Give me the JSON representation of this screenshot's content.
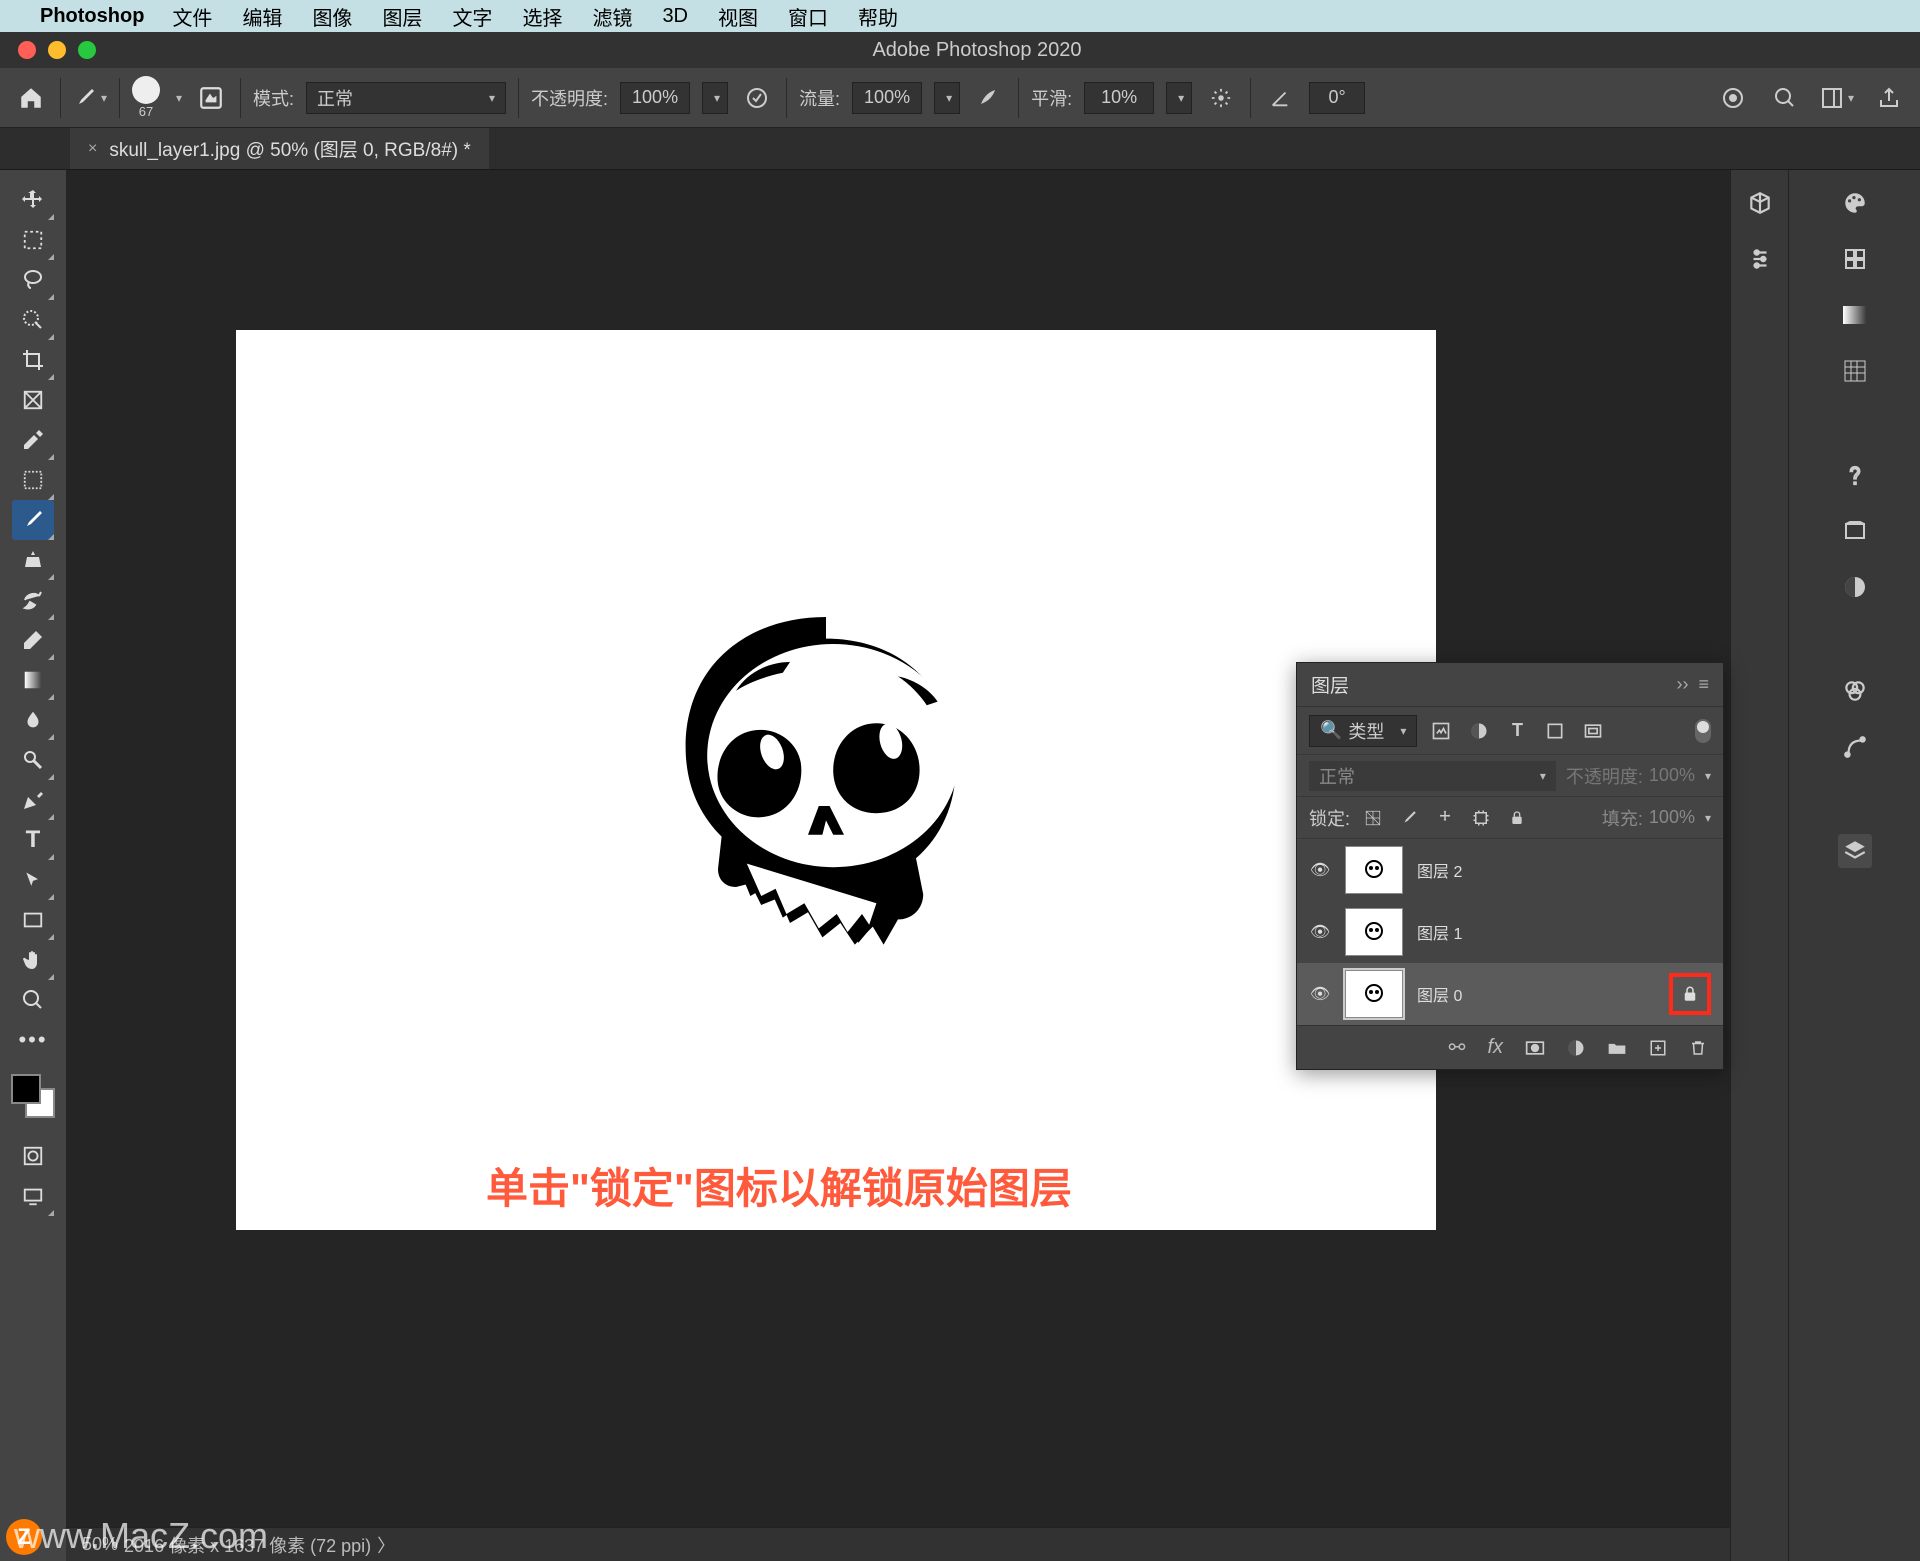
{
  "mac_menu": {
    "app": "Photoshop",
    "items": [
      "文件",
      "编辑",
      "图像",
      "图层",
      "文字",
      "选择",
      "滤镜",
      "3D",
      "视图",
      "窗口",
      "帮助"
    ]
  },
  "window_title": "Adobe Photoshop 2020",
  "options_bar": {
    "brush_size": "67",
    "mode_label": "模式:",
    "mode_value": "正常",
    "opacity_label": "不透明度:",
    "opacity_value": "100%",
    "flow_label": "流量:",
    "flow_value": "100%",
    "smooth_label": "平滑:",
    "smooth_value": "10%",
    "angle_value": "0°"
  },
  "tab": {
    "close": "×",
    "title": "skull_layer1.jpg @ 50% (图层 0, RGB/8#) *"
  },
  "layers_panel": {
    "title": "图层",
    "filter_label": "类型",
    "blend_mode": "正常",
    "opacity_label": "不透明度:",
    "opacity_value": "100%",
    "lock_label": "锁定:",
    "fill_label": "填充:",
    "fill_value": "100%",
    "layers": [
      {
        "name": "图层 2",
        "visible": true,
        "locked": false,
        "selected": false
      },
      {
        "name": "图层 1",
        "visible": true,
        "locked": false,
        "selected": false
      },
      {
        "name": "图层 0",
        "visible": true,
        "locked": true,
        "selected": true
      }
    ]
  },
  "status": {
    "zoom": "50%",
    "dims": "2016 像素 x 1637 像素 (72 ppi)",
    "chev": "〉"
  },
  "annotation": "单击\"锁定\"图标以解锁原始图层",
  "watermark": "www.MacZ.com",
  "zbadge": "Z"
}
